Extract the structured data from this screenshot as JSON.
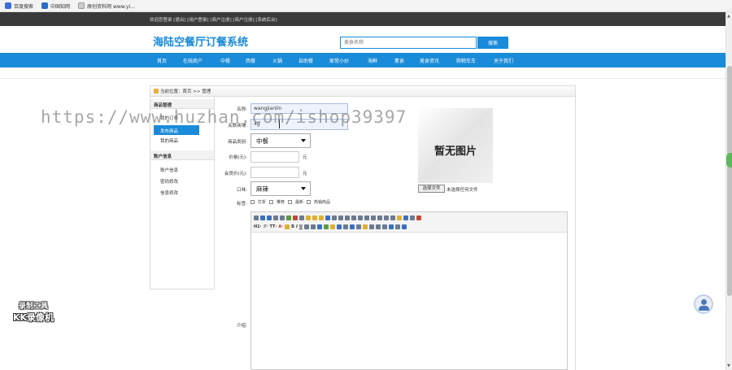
{
  "bookmarks": [
    {
      "label": "百度搜索",
      "color": "#3b6de0"
    },
    {
      "label": "中国知网",
      "color": "#2a6bc4"
    },
    {
      "label": "原创资料网 www.yi...",
      "color": "#cccccc"
    }
  ],
  "topbar": {
    "text": "欢迎您登录 [退出] [用户登录] [商户注册] [商户注册] [系统后台]"
  },
  "header": {
    "title": "海陆空餐厅订餐系统",
    "search_placeholder": "美食名称",
    "search_button": "搜索"
  },
  "nav": {
    "items": [
      "首页",
      "在线商户",
      "中餐",
      "西餐",
      "火锅",
      "自助餐",
      "家常小炒",
      "海鲜",
      "素食",
      "美食资讯",
      "购物车车",
      "关于我们"
    ]
  },
  "breadcrumb": "当前位置：首页 >> 管理",
  "sidebar": {
    "groups": [
      {
        "title": "商品管理",
        "items": [
          "我的订单",
          "发布商品",
          "我的商品"
        ]
      },
      {
        "title": "账户信息",
        "items": [
          "账户信息",
          "密码修改",
          "信息修改"
        ]
      }
    ],
    "active": "发布商品"
  },
  "form": {
    "name_label": "名称:",
    "name_value": "wangjianlin",
    "shop_label": "关联商铺:",
    "shop_value": "4g",
    "category_label": "商品类别:",
    "category_value": "中餐",
    "price_label": "价格(元):",
    "vip_price_label": "会员价(元):",
    "unit": "元",
    "taste_label": "口味:",
    "taste_value": "麻辣",
    "tags_label": "标签:",
    "tags": [
      "打折",
      "推荐",
      "最新",
      "热销商品"
    ],
    "intro_label": "介绍:",
    "image_placeholder": "暂无图片",
    "file_button": "选择文件",
    "file_status": "未选择任何文件"
  },
  "editor": {
    "toolbar_text": [
      "H1·",
      "ℱ·",
      "TT·",
      "A·"
    ]
  },
  "watermark": "https://www.huzhan.com/ishop39397",
  "recorder": {
    "line1": "录制工具",
    "line2": "KK录像机"
  },
  "colors": {
    "accent": "#1a8bd8",
    "topbar": "#3a3a3a"
  }
}
